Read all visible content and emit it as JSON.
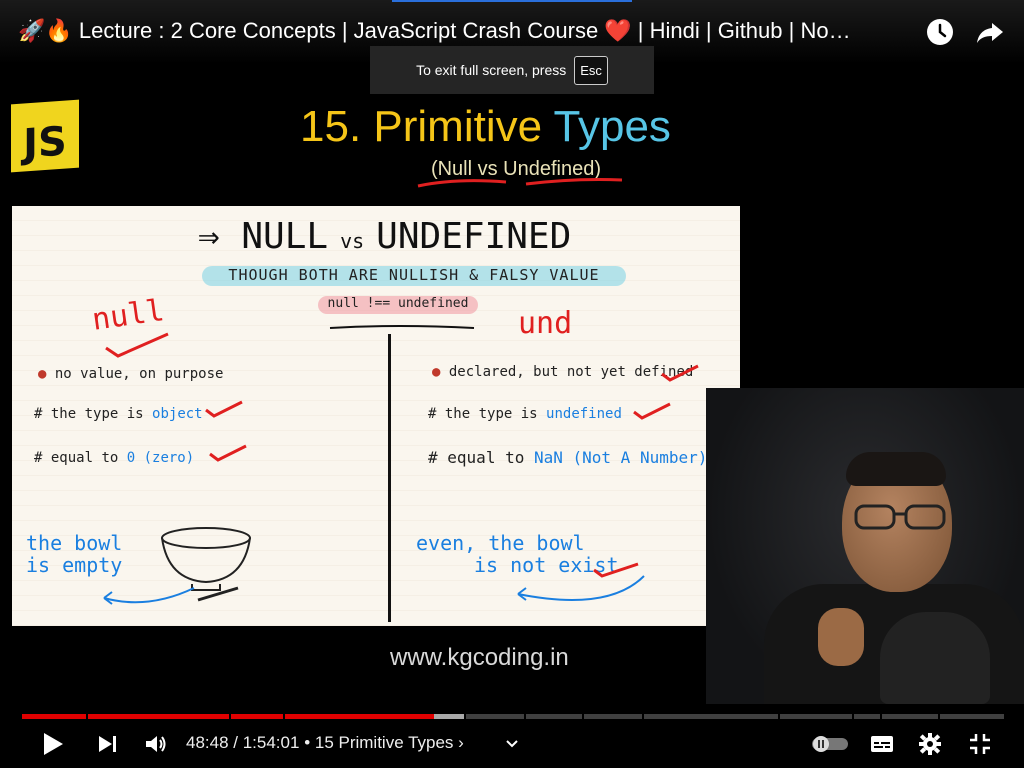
{
  "video": {
    "title": "🚀🔥 Lecture : 2 Core Concepts | JavaScript Crash Course ❤️ | Hindi | Github | No…"
  },
  "toast": {
    "text": "To exit full screen, press",
    "key": "Esc"
  },
  "slide": {
    "logo_text": "JS",
    "title_number": "15.",
    "title_word1": "Primitive",
    "title_word2": "Types",
    "subtitle": "(Null vs Undefined)",
    "board": {
      "heading_left": "NULL",
      "heading_vs": "vs",
      "heading_right": "UNDEFINED",
      "tag_main": "THOUGH BOTH ARE NULLISH & FALSY VALUE",
      "tag_compare": "null !== undefined",
      "left_label": "null",
      "right_label": "und",
      "left_bullets": [
        {
          "prefix": "●",
          "text": "no value, on purpose",
          "highlight": ""
        },
        {
          "prefix": "#",
          "text": "the type is ",
          "highlight": "object"
        },
        {
          "prefix": "#",
          "text": "equal to ",
          "highlight": "0 (zero)"
        }
      ],
      "right_bullets": [
        {
          "prefix": "●",
          "text": "declared, but not yet defined",
          "highlight": ""
        },
        {
          "prefix": "#",
          "text": "the type is ",
          "highlight": "undefined"
        },
        {
          "prefix": "#",
          "text": "equal to ",
          "highlight": "NaN (Not A Number)"
        }
      ],
      "left_note_line1": "the bowl",
      "left_note_line2": "is empty",
      "right_note_line1": "even, the bowl",
      "right_note_line2": "is not exist"
    },
    "website": "www.kgcoding.in"
  },
  "player": {
    "current_time": "48:48",
    "duration": "1:54:01",
    "chapter": "• 15 Primitive Types",
    "time_separator": " / ",
    "progress": 0.42,
    "colors": {
      "played": "#e00000",
      "accent": "#2a6fdb"
    },
    "icons": {
      "play": "play-icon",
      "next": "next-icon",
      "volume": "volume-icon",
      "chapter_chevron": "chevron-down-icon",
      "autoplay": "autoplay-toggle",
      "subtitles": "subtitles-icon",
      "settings": "gear-icon",
      "fullscreen_exit": "exit-fullscreen-icon",
      "watch_later": "clock-icon",
      "share": "share-icon"
    }
  }
}
